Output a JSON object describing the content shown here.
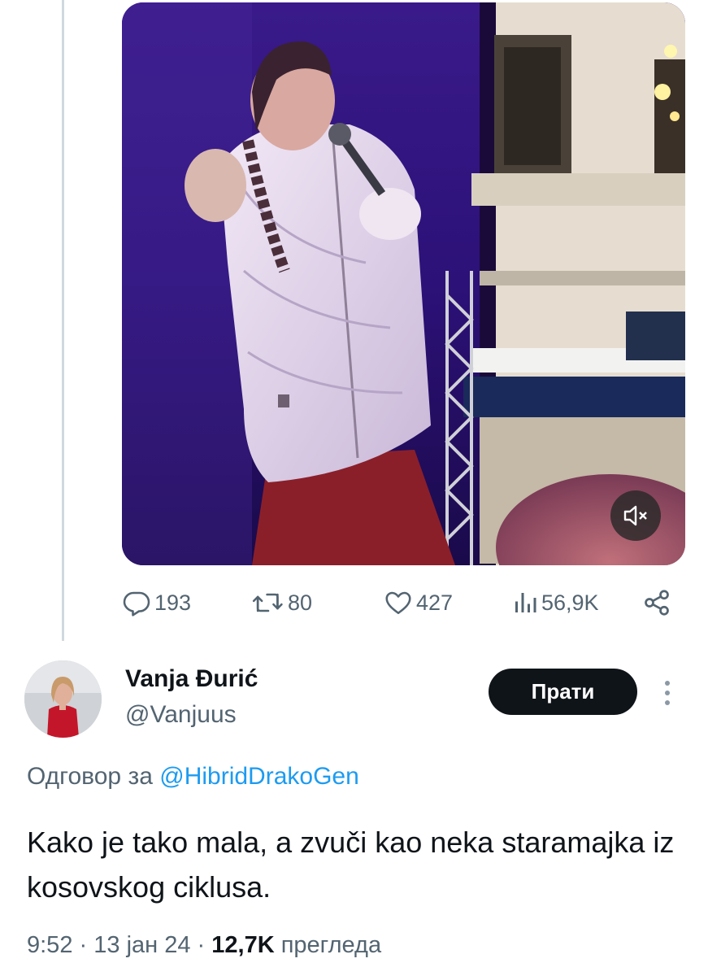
{
  "media": {
    "mute_icon": "volume-muted-icon"
  },
  "actions": {
    "replies": "193",
    "retweets": "80",
    "likes": "427",
    "views": "56,9K",
    "icons": [
      "reply-icon",
      "retweet-icon",
      "like-icon",
      "views-icon",
      "share-icon"
    ]
  },
  "reply": {
    "author_name": "Vanja Đurić",
    "author_handle": "@Vanjuus",
    "follow_label": "Прати",
    "reply_prefix": "Одговор за",
    "reply_mention": "@HibridDrakoGen",
    "text": "Kako je tako mala, a zvuči kao neka staramajka iz kosovskog ciklusa.",
    "time": "9:52",
    "date": "13 јан 24",
    "separator": "·",
    "views_count": "12,7K",
    "views_label": "прегледа"
  },
  "colors": {
    "text_primary": "#0f1419",
    "text_secondary": "#536471",
    "link": "#1d9bf0",
    "thread_line": "#cfd9de",
    "follow_bg": "#0f1419"
  }
}
